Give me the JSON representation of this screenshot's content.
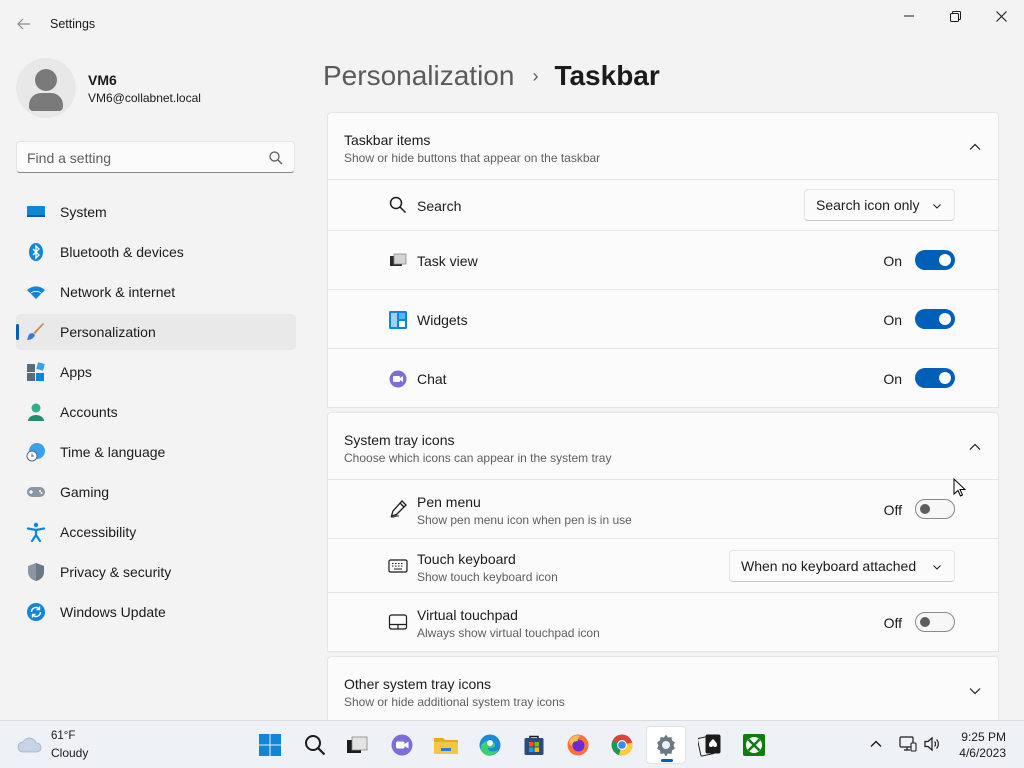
{
  "window": {
    "title": "Settings",
    "back_label": "←"
  },
  "profile": {
    "name": "VM6",
    "email": "VM6@collabnet.local"
  },
  "search": {
    "placeholder": "Find a setting"
  },
  "nav": {
    "items": [
      {
        "label": "System",
        "icon": "system-icon"
      },
      {
        "label": "Bluetooth & devices",
        "icon": "bluetooth-icon"
      },
      {
        "label": "Network & internet",
        "icon": "wifi-icon"
      },
      {
        "label": "Personalization",
        "icon": "brush-icon",
        "selected": true
      },
      {
        "label": "Apps",
        "icon": "apps-icon"
      },
      {
        "label": "Accounts",
        "icon": "accounts-icon"
      },
      {
        "label": "Time & language",
        "icon": "globe-clock-icon"
      },
      {
        "label": "Gaming",
        "icon": "gamepad-icon"
      },
      {
        "label": "Accessibility",
        "icon": "accessibility-icon"
      },
      {
        "label": "Privacy & security",
        "icon": "shield-icon"
      },
      {
        "label": "Windows Update",
        "icon": "update-icon"
      }
    ]
  },
  "breadcrumb": {
    "parent": "Personalization",
    "separator": "›",
    "current": "Taskbar"
  },
  "sections": {
    "taskbar_items": {
      "title": "Taskbar items",
      "subtitle": "Show or hide buttons that appear on the taskbar",
      "expanded": true,
      "rows": {
        "search": {
          "label": "Search",
          "value": "Search icon only"
        },
        "task_view": {
          "label": "Task view",
          "state": "On",
          "on": true
        },
        "widgets": {
          "label": "Widgets",
          "state": "On",
          "on": true
        },
        "chat": {
          "label": "Chat",
          "state": "On",
          "on": true
        }
      }
    },
    "system_tray": {
      "title": "System tray icons",
      "subtitle": "Choose which icons can appear in the system tray",
      "expanded": true,
      "rows": {
        "pen_menu": {
          "label": "Pen menu",
          "description": "Show pen menu icon when pen is in use",
          "state": "Off",
          "on": false
        },
        "touch_keyboard": {
          "label": "Touch keyboard",
          "description": "Show touch keyboard icon",
          "value": "When no keyboard attached"
        },
        "virtual_touchpad": {
          "label": "Virtual touchpad",
          "description": "Always show virtual touchpad icon",
          "state": "Off",
          "on": false
        }
      }
    },
    "other_tray": {
      "title": "Other system tray icons",
      "subtitle": "Show or hide additional system tray icons",
      "expanded": false
    }
  },
  "taskbar": {
    "weather": {
      "temp": "61°F",
      "condition": "Cloudy"
    },
    "apps": [
      "start-icon",
      "search-icon",
      "task-view-icon",
      "chat-icon",
      "file-explorer-icon",
      "edge-icon",
      "store-icon",
      "firefox-icon",
      "chrome-icon",
      "settings-icon",
      "solitaire-icon",
      "xbox-icon"
    ],
    "active_app": "settings-icon",
    "clock": {
      "time": "9:25 PM",
      "date": "4/6/2023"
    }
  },
  "colors": {
    "accent": "#005fb8",
    "background": "#f3f3f3",
    "card": "#fbfbfb"
  }
}
